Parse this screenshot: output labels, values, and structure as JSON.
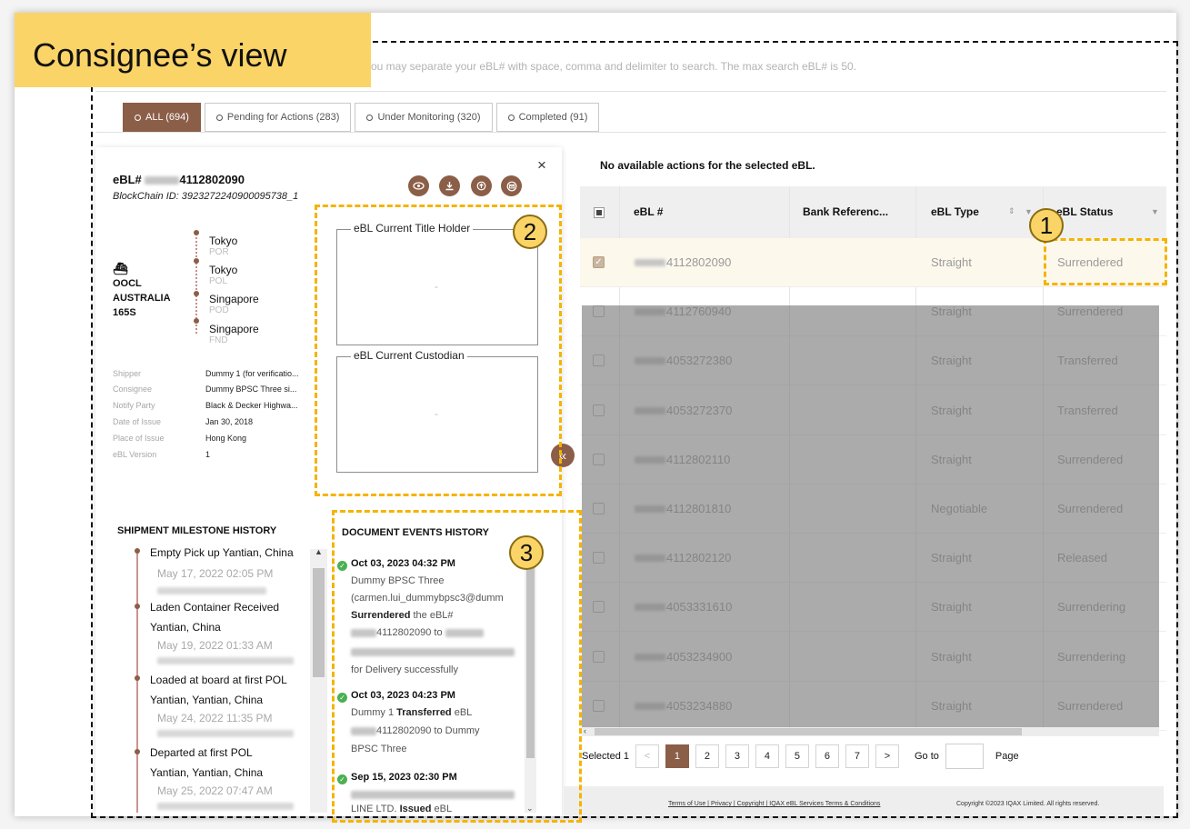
{
  "view_label": "Consignee’s view",
  "search_hint": "ou may separate your eBL# with space, comma and delimiter to search. The max search eBL# is 50.",
  "tabs": [
    {
      "label": "ALL (694)"
    },
    {
      "label": "Pending for Actions (283)"
    },
    {
      "label": "Under Monitoring (320)"
    },
    {
      "label": "Completed (91)"
    }
  ],
  "panel": {
    "close": "×",
    "ebl_prefix": "eBL#",
    "ebl_suffix": "4112802090",
    "blockchain_id": "BlockChain ID: 3923272240900095738_1",
    "action_icons": [
      "eye-icon",
      "download-icon",
      "upload-icon",
      "mail-icon"
    ],
    "vessel": {
      "icon": "ship-icon",
      "line1": "OOCL",
      "line2": "AUSTRALIA",
      "line3": "165S"
    },
    "route": [
      {
        "port": "Tokyo",
        "code": "POR"
      },
      {
        "port": "Tokyo",
        "code": "POL"
      },
      {
        "port": "Singapore",
        "code": "POD"
      },
      {
        "port": "Singapore",
        "code": "FND"
      }
    ],
    "details": [
      {
        "k": "Shipper",
        "v": "Dummy 1 (for verificatio..."
      },
      {
        "k": "Consignee",
        "v": "Dummy BPSC Three si..."
      },
      {
        "k": "Notify Party",
        "v": "Black & Decker Highwa..."
      },
      {
        "k": "Date of Issue",
        "v": "Jan 30, 2018"
      },
      {
        "k": "Place of Issue",
        "v": "Hong Kong"
      },
      {
        "k": "eBL Version",
        "v": "1"
      }
    ],
    "title_holder_label": "eBL Current Title Holder",
    "title_holder_value": "-",
    "custodian_label": "eBL Current Custodian",
    "custodian_value": "-",
    "milestone_title": "SHIPMENT MILESTONE HISTORY",
    "milestones": [
      {
        "l1": "Empty Pick up Yantian, China",
        "date": "May 17, 2022 02:05 PM"
      },
      {
        "l1": "Laden Container Received",
        "l2": "Yantian, China",
        "date": "May 19, 2022 01:33 AM"
      },
      {
        "l1": "Loaded at board at first POL",
        "l2": "Yantian, Yantian, China",
        "date": "May 24, 2022 11:35 PM"
      },
      {
        "l1": "Departed at first POL",
        "l2": "Yantian, Yantian, China",
        "date": "May 25, 2022 07:47 AM"
      }
    ],
    "events_title": "DOCUMENT EVENTS HISTORY",
    "events": [
      {
        "date": "Oct 03, 2023 04:32 PM",
        "lines": [
          "Dummy BPSC Three",
          "(carmen.lui_dummybpsc3@dumm"
        ],
        "action": "Surrendered",
        "action_rest": " the eBL#",
        "tail": [
          "4112802090 to",
          "for Delivery successfully"
        ]
      },
      {
        "date": "Oct 03, 2023 04:23 PM",
        "lines": [
          "Dummy 1"
        ],
        "action": "Transferred",
        "action_rest": " eBL",
        "tail": [
          "4112802090 to Dummy",
          "BPSC Three"
        ]
      },
      {
        "date": "Sep 15, 2023 02:30 PM",
        "lines": [],
        "action": "Issued",
        "action_rest": " eBL",
        "prefix": "LINE LTD. ",
        "tail": []
      }
    ]
  },
  "badges": [
    "1",
    "2",
    "3"
  ],
  "table": {
    "no_actions": "No available actions for the selected eBL.",
    "headers": {
      "ebl": "eBL #",
      "bank": "Bank Referenc...",
      "type": "eBL Type",
      "status": "eBL Status"
    },
    "rows": [
      {
        "ebl": "4112802090",
        "type": "Straight",
        "status": "Surrendered",
        "checked": true
      },
      {
        "ebl": "4112760940",
        "type": "Straight",
        "status": "Surrendered"
      },
      {
        "ebl": "4053272380",
        "type": "Straight",
        "status": "Transferred"
      },
      {
        "ebl": "4053272370",
        "type": "Straight",
        "status": "Transferred"
      },
      {
        "ebl": "4112802110",
        "type": "Straight",
        "status": "Surrendered"
      },
      {
        "ebl": "4112801810",
        "type": "Negotiable",
        "status": "Surrendered"
      },
      {
        "ebl": "4112802120",
        "type": "Straight",
        "status": "Released"
      },
      {
        "ebl": "4053331610",
        "type": "Straight",
        "status": "Surrendering"
      },
      {
        "ebl": "4053234900",
        "type": "Straight",
        "status": "Surrendering"
      },
      {
        "ebl": "4053234880",
        "type": "Straight",
        "status": "Surrendered"
      }
    ]
  },
  "pager": {
    "selected": "Selected 1",
    "prev": "<",
    "pages": [
      "1",
      "2",
      "3",
      "4",
      "5",
      "6",
      "7"
    ],
    "next": ">",
    "goto": "Go to",
    "page": "Page"
  },
  "footer": {
    "links": "Terms of Use | Privacy | Copyright | IQAX eBL Services Terms & Conditions",
    "copyright": "Copyright ©2023 IQAX Limited. All rights reserved."
  },
  "colors": {
    "accent": "#8b5e48",
    "highlight": "#f4b400",
    "badge": "#fbd467"
  }
}
